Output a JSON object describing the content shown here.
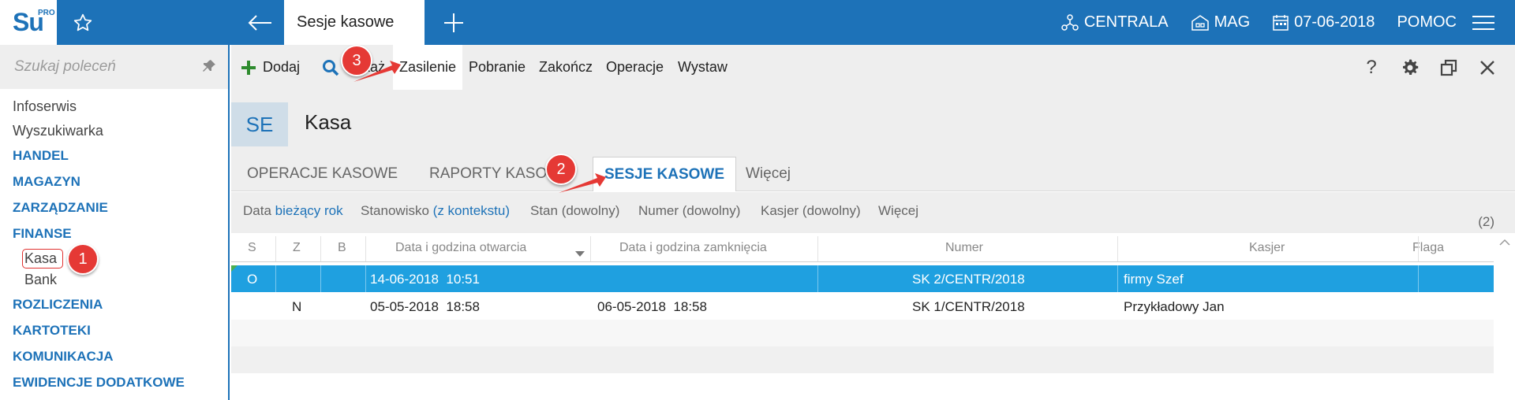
{
  "app": {
    "logo_text": "Su",
    "logo_sup": "PRO",
    "active_tab": "Sesje kasowe"
  },
  "top_right": {
    "centrala": "CENTRALA",
    "mag": "MAG",
    "date": "07-06-2018",
    "help": "POMOC"
  },
  "sidebar": {
    "search_placeholder": "Szukaj poleceń",
    "items": [
      {
        "label": "Infoserwis"
      },
      {
        "label": "Wyszukiwarka"
      },
      {
        "label": "HANDEL"
      },
      {
        "label": "MAGAZYN"
      },
      {
        "label": "ZARZĄDZANIE"
      },
      {
        "label": "FINANSE"
      },
      {
        "label": "Kasa"
      },
      {
        "label": "Bank"
      },
      {
        "label": "ROZLICZENIA"
      },
      {
        "label": "KARTOTEKI"
      },
      {
        "label": "KOMUNIKACJA"
      },
      {
        "label": "EWIDENCJE DODATKOWE"
      }
    ]
  },
  "toolbar": {
    "add": "Dodaj",
    "show": "Pokaż",
    "zasilenie": "Zasilenie",
    "pobranie": "Pobranie",
    "zakoncz": "Zakończ",
    "operacje": "Operacje",
    "wystaw": "Wystaw",
    "help": "?"
  },
  "header": {
    "badge": "SE",
    "title": "Kasa"
  },
  "tabs": [
    {
      "label": "OPERACJE KASOWE"
    },
    {
      "label": "RAPORTY KASOWE"
    },
    {
      "label": "SESJE KASOWE"
    },
    {
      "label": "Więcej"
    }
  ],
  "filters": {
    "data_label": "Data",
    "data_value": "bieżący rok",
    "stanowisko_label": "Stanowisko",
    "stanowisko_value": "(z kontekstu)",
    "stan": "Stan (dowolny)",
    "numer": "Numer (dowolny)",
    "kasjer": "Kasjer (dowolny)",
    "more": "Więcej",
    "count": "(2)"
  },
  "grid": {
    "columns": [
      "S",
      "Z",
      "B",
      "Data i godzina otwarcia",
      "Data i godzina zamknięcia",
      "Numer",
      "Kasjer",
      "Flaga"
    ],
    "rows": [
      {
        "s": "O",
        "z": "",
        "b": "",
        "open": "14-06-2018  10:51",
        "close": "",
        "numer": "SK 2/CENTR/2018",
        "kasjer": "firmy Szef",
        "flaga": ""
      },
      {
        "s": "",
        "z": "N",
        "b": "",
        "open": "05-05-2018  18:58",
        "close": "06-05-2018  18:58",
        "numer": "SK 1/CENTR/2018",
        "kasjer": "Przykładowy Jan",
        "flaga": ""
      }
    ]
  },
  "annotations": {
    "one": "1",
    "two": "2",
    "three": "3"
  },
  "colors": {
    "brand": "#1d72b8",
    "selection": "#1fa0e0",
    "annotation": "#e53935"
  }
}
